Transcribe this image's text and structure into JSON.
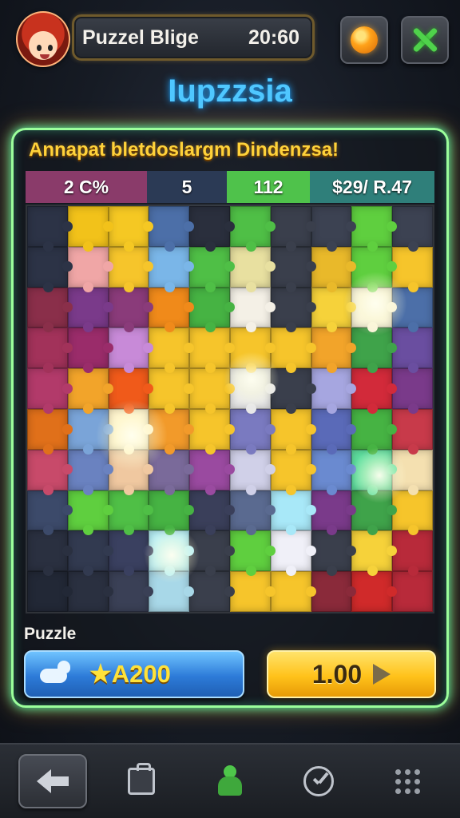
{
  "header": {
    "title": "Puzzel Blige",
    "timer": "20:60",
    "avatar_icon": "character-avatar",
    "gem_icon": "orange-gem-icon",
    "close_icon": "close-icon"
  },
  "game_title": "Iupzzsia",
  "board": {
    "banner": "Annapat bletdoslargm Dindenzsa!",
    "stats": [
      "2 C%",
      "5",
      "112",
      "$29/ R.47"
    ],
    "stat_colors": [
      "#8a3b6a",
      "#2b3a55",
      "#4fc24b",
      "#2f7f7a"
    ],
    "rows": [
      [
        "#2c3346",
        "#f2c21a",
        "#f5c823",
        "#4c6fa8",
        "#2a2f3d",
        "#4fbf46",
        "#3a3f4c",
        "#3c4252",
        "#5fcf3f",
        "#3c4252"
      ],
      [
        "#2c3346",
        "#f0a6a6",
        "#f6c52b",
        "#7ab6e8",
        "#4fbf46",
        "#e8e0a0",
        "#3a3f4c",
        "#e9b92a",
        "#5fcf3f",
        "#f6c52b"
      ],
      [
        "#8a2f4a",
        "#7a3a8a",
        "#8a3b7a",
        "#f08a1a",
        "#46b343",
        "#f4f0e6",
        "#3a3f4c",
        "#f6d23a",
        "#f8f2d8",
        "#4c6fa8"
      ],
      [
        "#a2325a",
        "#9a2c6a",
        "#c88ad8",
        "#f6c52b",
        "#f6c52b",
        "#f6c52b",
        "#f6c52b",
        "#f2a42a",
        "#3fa34a",
        "#6a4ea0"
      ],
      [
        "#b23a6a",
        "#f2a42a",
        "#f05a1a",
        "#f6c52b",
        "#f6c52b",
        "#e8e8e8",
        "#3a3f4c",
        "#a6a6e0",
        "#d22a3a",
        "#7a3a8a"
      ],
      [
        "#e0701a",
        "#7aa4d8",
        "#fff2c8",
        "#f29a2a",
        "#f6c52b",
        "#7a7ac0",
        "#f6c52b",
        "#5a6ab8",
        "#46b343",
        "#c83a4a"
      ],
      [
        "#c84a6a",
        "#6a82c0",
        "#f0c8a0",
        "#7a6a9a",
        "#9a4aa0",
        "#d0d0e8",
        "#f6c52b",
        "#6a8ad0",
        "#5fe0a0",
        "#f4e0b0"
      ],
      [
        "#3c4a6a",
        "#5fcf3f",
        "#4fbf46",
        "#46b343",
        "#3a3f5a",
        "#5a6a90",
        "#a8e8f8",
        "#7a3a8a",
        "#3fa34a",
        "#f6c52b"
      ],
      [
        "#2a3040",
        "#323a50",
        "#3a4060",
        "#b8f0f8",
        "#3a3f4c",
        "#5fcf3f",
        "#f0f0f8",
        "#3a3f4c",
        "#f6d23a",
        "#b82a3a"
      ],
      [
        "#222836",
        "#2a3040",
        "#3a4056",
        "#a8d8e8",
        "#3a3f4c",
        "#f6c52b",
        "#f6c52b",
        "#8a2a3a",
        "#d02a2a",
        "#b82a3a"
      ]
    ]
  },
  "footer": {
    "puzzle_label": "Puzzle",
    "reward_value": "★A200",
    "reward_icon": "dog-icon",
    "play_value": "1.00",
    "play_icon": "play-arrow-icon"
  },
  "nav": {
    "items": [
      "back-arrow-icon",
      "bag-icon",
      "pawn-icon",
      "clock-icon",
      "grid-dots-icon"
    ],
    "active_index": 0
  }
}
